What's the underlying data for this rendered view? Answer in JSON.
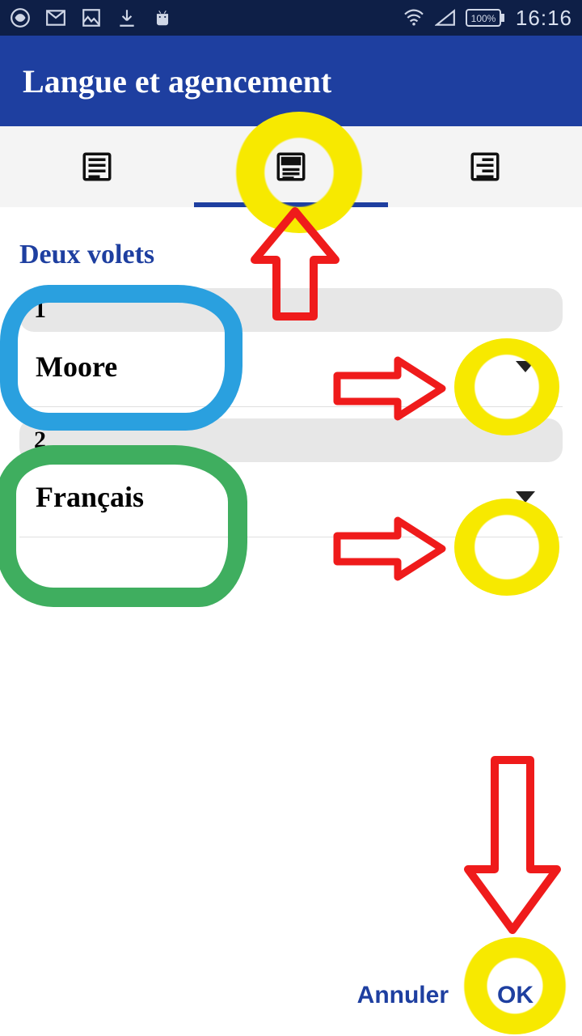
{
  "statusbar": {
    "time": "16:16",
    "battery": "100%",
    "icons": [
      "phoenix-icon",
      "gmail-icon",
      "gallery-icon",
      "download-icon",
      "android-icon",
      "wifi-icon",
      "signal-icon",
      "battery-icon"
    ]
  },
  "appbar": {
    "title": "Langue et agencement"
  },
  "tabs": {
    "items": [
      "single-pane",
      "two-pane",
      "verse-by-verse"
    ],
    "active_index": 1
  },
  "section": {
    "title": "Deux volets",
    "panes": [
      {
        "num": "1",
        "lang": "Moore"
      },
      {
        "num": "2",
        "lang": "Français"
      }
    ]
  },
  "footer": {
    "cancel": "Annuler",
    "ok": "OK"
  }
}
